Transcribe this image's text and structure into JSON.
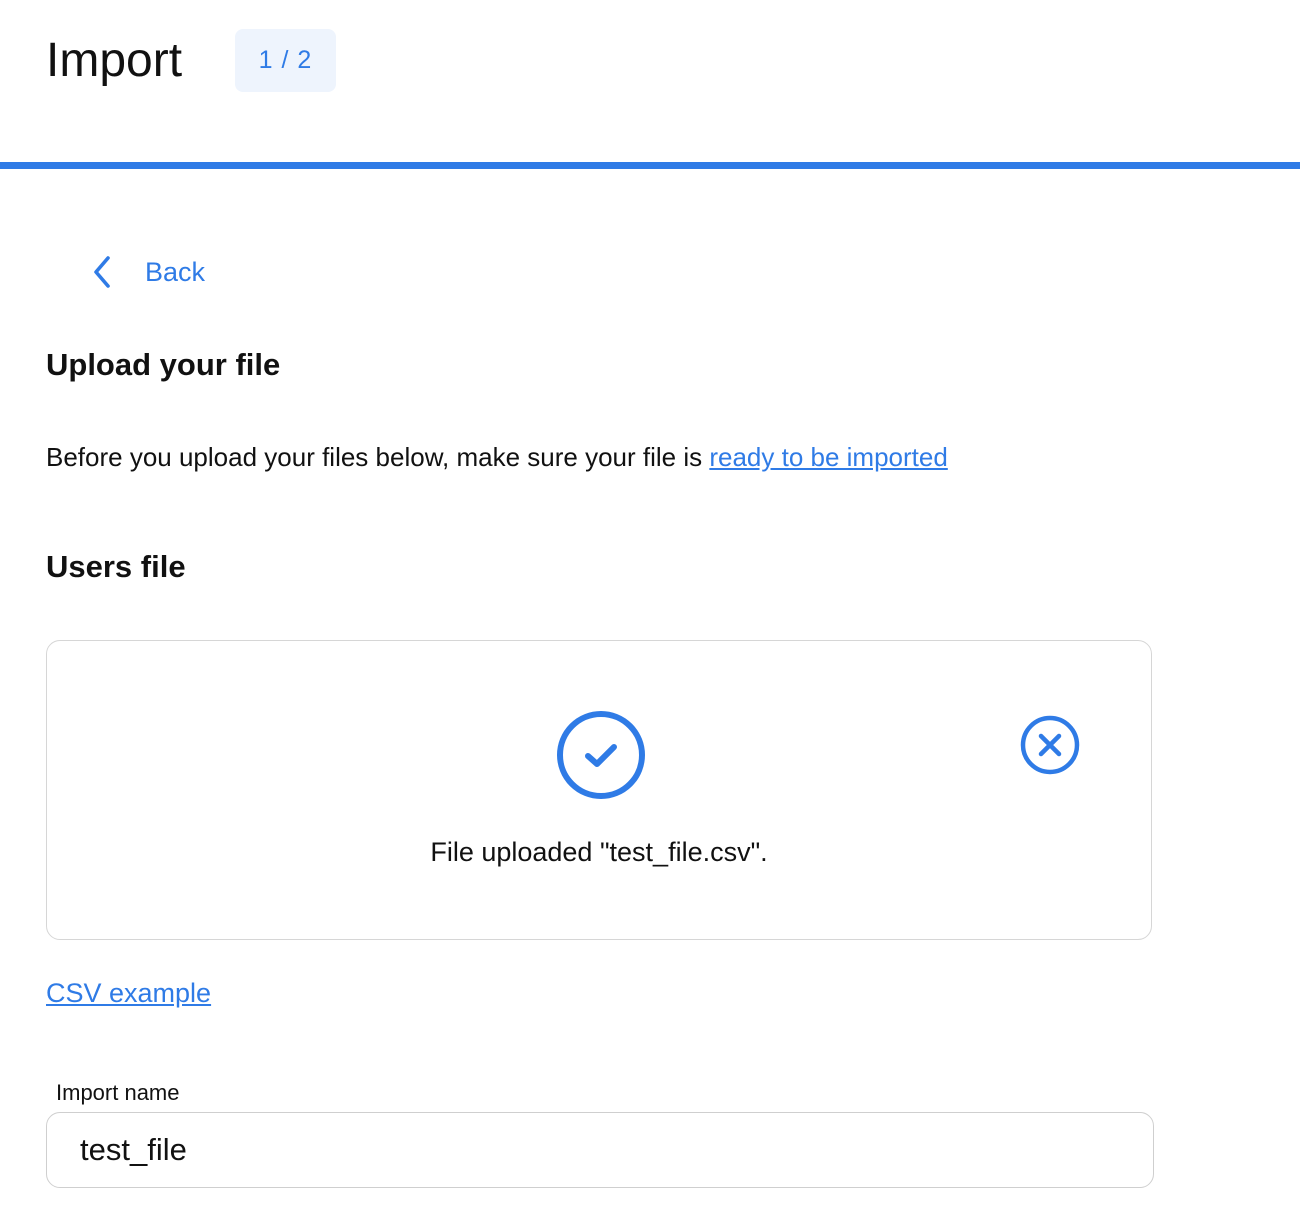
{
  "header": {
    "title": "Import",
    "step": "1 / 2"
  },
  "colors": {
    "accent": "#2f7be6",
    "badge_bg": "#eef4fd",
    "text": "#111111",
    "border": "#d6d6d6"
  },
  "nav": {
    "back_label": "Back",
    "back_icon": "chevron-left-icon"
  },
  "upload_section": {
    "title": "Upload your file",
    "intro_text": "Before you upload your files below, make sure your file is ",
    "intro_link": "ready to be imported"
  },
  "users_file": {
    "title": "Users file",
    "status_icon": "check-circle-icon",
    "remove_icon": "close-circle-icon",
    "status_text": "File uploaded \"test_file.csv\".",
    "csv_example_link": "CSV example"
  },
  "import_name": {
    "label": "Import name",
    "value": "test_file",
    "placeholder": ""
  }
}
